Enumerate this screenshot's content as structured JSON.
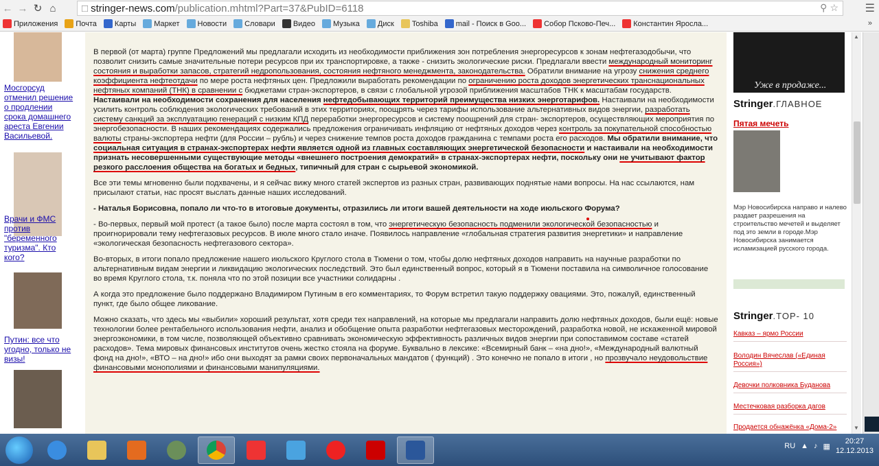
{
  "browser": {
    "url_host": "stringer-news.com",
    "url_path": "/publication.mhtml?Part=37&PubID=6118",
    "bookmarks": [
      {
        "label": "Приложения",
        "color": "#e33"
      },
      {
        "label": "Почта",
        "color": "#e8a317"
      },
      {
        "label": "Карты",
        "color": "#36c"
      },
      {
        "label": "Маркет",
        "color": "#6ad"
      },
      {
        "label": "Новости",
        "color": "#6ad"
      },
      {
        "label": "Словари",
        "color": "#6ad"
      },
      {
        "label": "Видео",
        "color": "#333"
      },
      {
        "label": "Музыка",
        "color": "#6ad"
      },
      {
        "label": "Диск",
        "color": "#6ad"
      },
      {
        "label": "Toshiba",
        "color": "#e8c55a"
      },
      {
        "label": "mail - Поиск в Goo...",
        "color": "#36c"
      },
      {
        "label": "Собор Псково-Печ...",
        "color": "#e33"
      },
      {
        "label": "Константин Яросла...",
        "color": "#e33"
      }
    ],
    "more": "»"
  },
  "left_col": {
    "captions": [
      "Мосгорсуд отменил решение о продлении срока домашнего ареста Евгении Васильевой.",
      "Врачи и ФМС против \"беременного туризма\". Кто кого?",
      "Путин: все что угодно, только не визы!"
    ]
  },
  "article": {
    "p1_a": "В первой (от марта) группе Предложений мы предлагали исходить из необходимости приближения зон потребления энергоресурсов к зонам нефтегазодобычи, что позволит снизить самые значительные потери ресурсов при их транспортировке, а также - снизить экологические риски. Предлагали ввести ",
    "p1_u1": "международный мониторинг состояния и выработки запасов, стратегий недропользования, состояния нефтяного менеджмента, законодательства.",
    "p1_b": " Обратили внимание на угрозу ",
    "p1_u2": "снижения среднего коэффициента нефтеотдачи",
    "p1_c": " по мере роста нефтяных цен. Предложили выработать рекомендации по ",
    "p1_u3": "ограничению роста доходов энергетических транснациональных нефтяных компаний (ТНК) в сравнении с",
    "p1_d": " бюджетами стран-экспортеров, в связи с глобальной угрозой приближения масштабов ТНК к масштабам государств. ",
    "p1_bold1": "Настаивали на необходимости сохранения для населения ",
    "p1_bold2": "нефтедобывающих территорий преимущества низких энерготарифов.",
    "p1_e": " Настаивали на необходимости усилить контроль соблюдения экологических требований в этих территориях, поощрять через тарифы использование альтернативных видов энергии, ",
    "p1_u4": "разработать систему санкций за эксплуатацию генераций с низким КПД",
    "p1_f": " переработки энергоресурсов и систему поощрений для стран- экспортеров, осуществляющих мероприятия по энергобезопасности. В наших рекомендациях содержались предложения ограничивать инфляцию от нефтяных доходов через ",
    "p1_u5": "контроль за покупательной способностью валюты",
    "p1_g": " страны-экспортера нефти (для России – рубль) и через снижение темпов роста доходов гражданина с темпами роста его расходов. ",
    "p1_bold3": "Мы обратили внимание, что ",
    "p1_ub1": "социальная ситуация в странах-экспортерах нефти является одной из главных составляющих энергетической безопасности",
    "p1_bold4": " и настаивали на необходимости признать несовершенными существующие методы «внешнего построения демократий» в странах-экспортерах нефти, поскольку они ",
    "p1_ub2": "не учитывают фактор резкого расслоения общества на богатых и бедных",
    "p1_bold5": ", типичный для стран с сырьевой экономикой.",
    "p2": "Все эти темы мгновенно были подхвачены, и я сейчас вижу много статей экспертов из разных стран, развивающих поднятые нами вопросы. На нас ссылаются, нам присылают статьи, нас просят выслать данные наших исследований.",
    "q1": "- Наталья Борисовна, попало ли что-то в итоговые документы, отразились ли итоги вашей деятельности на ходе июльского Форума?",
    "p3_a": "- Во-первых, первый мой протест (а такое было) после марта состоял в том, что ",
    "p3_u": "энергетическую безопасность подменили экологической безопасностью",
    "p3_b": " и проигнорировали тему нефтегазовых ресурсов. В июле много стало иначе. Появилось направление «глобальная стратегия развития энергетики» и направление «экологическая безопасность нефтегазового сектора».",
    "p4": "Во-вторых, в итоги попало предложение нашего июльского Круглого стола в Тюмени о том, чтобы долю нефтяных доходов направить на научные разработки по альтернативным видам энергии и ликвидацию экологических последствий. Это был единственный вопрос, который я в Тюмени поставила на символичное голосование во время Круглого стола, т.к. поняла что по этой позиции все участники солидарны .",
    "p5": "А когда это предложение было поддержано Владимиром Путиным в его комментариях, то Форум встретил такую поддержку овациями. Это, пожалуй, единственный пункт, где было общее ликование.",
    "p6_a": "Можно сказать, что здесь мы «выбили» хороший результат, хотя среди тех направлений, на которые мы предлагали направить долю нефтяных доходов, были ещё: новые технологии более рентабельного использования нефти, анализ и обобщение опыта разработки нефтегазовых месторождений, разработка новой, не искаженной мировой энергоэкономики, в том числе, позволяющей объективно сравнивать экономическую эффективность различных видов энергии при сопоставимом составе «статей расходов». Тема мировых финансовых институтов очень жестко стояла на форуме. Буквально в лексике: «Всемирный банк – «на дно!», «Международный валютный фонд на дно!», «ВТО – на дно!» ибо они выходят за рамки своих первоначальных мандатов ( функций) . Это конечно не попало в итоги , но ",
    "p6_u": "прозвучало неудовольствие финансовыми монополиями и финансовыми манипуляциями."
  },
  "right_col": {
    "ad_text": "Уже в продаже...",
    "brand": "Stringer",
    "section1": ".ГЛАВНОЕ",
    "feature_link": "Пятая мечеть",
    "feature_text": "Мэр Новосибирска направо и налево раздает разрешения на строительство мечетей и выделяет под это земли в городе.Мэр Новосибирска занимается исламизацией русского города.",
    "section2": ".TOP- 10",
    "top_items": [
      "Кавказ – ярмо России",
      "Володин Вячеслав («Единая Россия»)",
      "Девочки полковника Буданова",
      "Местечковая разборка дагов",
      "Продается обнажёнка «Дома-2»"
    ]
  },
  "taskbar": {
    "lang": "RU",
    "time": "20:27",
    "date": "12.12.2013"
  }
}
